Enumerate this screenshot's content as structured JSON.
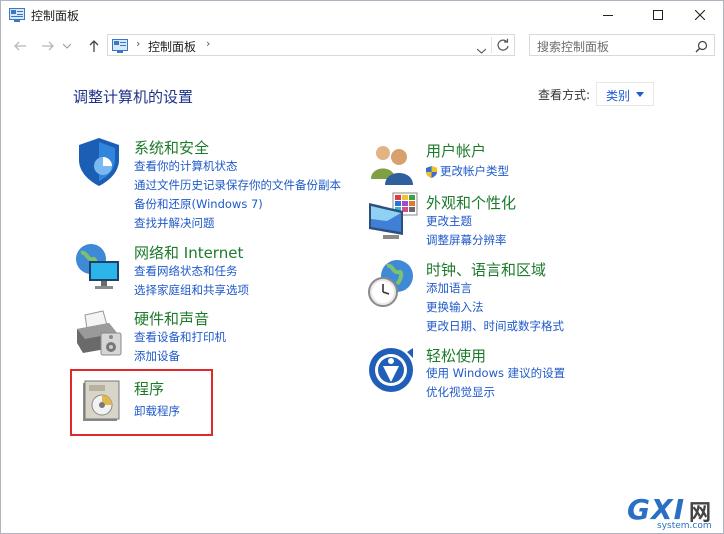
{
  "window": {
    "title": "控制面板",
    "controls": [
      "minimize-icon",
      "maximize-icon",
      "close-icon"
    ]
  },
  "nav": {
    "back_icon": "back-arrow-icon",
    "forward_icon": "forward-arrow-icon",
    "recent_icon": "chevron-down-icon",
    "up_icon": "up-arrow-icon",
    "breadcrumb": "控制面板",
    "search_placeholder": "搜索控制面板"
  },
  "main": {
    "heading": "调整计算机的设置",
    "view_by_label": "查看方式:",
    "view_by_value": "类别"
  },
  "categories_left": [
    {
      "title": "系统和安全",
      "icon": "shield-icon",
      "links": [
        "查看你的计算机状态",
        "通过文件历史记录保存你的文件备份副本",
        "备份和还原(Windows 7)",
        "查找并解决问题"
      ]
    },
    {
      "title": "网络和 Internet",
      "icon": "network-globe-icon",
      "links": [
        "查看网络状态和任务",
        "选择家庭组和共享选项"
      ]
    },
    {
      "title": "硬件和声音",
      "icon": "printer-icon",
      "links": [
        "查看设备和打印机",
        "添加设备"
      ]
    },
    {
      "title": "程序",
      "icon": "program-disc-icon",
      "links": [
        "卸载程序"
      ]
    }
  ],
  "categories_right": [
    {
      "title": "用户帐户",
      "icon": "users-icon",
      "links": [
        "更改帐户类型"
      ]
    },
    {
      "title": "外观和个性化",
      "icon": "monitor-palette-icon",
      "links": [
        "更改主题",
        "调整屏幕分辨率"
      ]
    },
    {
      "title": "时钟、语言和区域",
      "icon": "clock-globe-icon",
      "links": [
        "添加语言",
        "更换输入法",
        "更改日期、时间或数字格式"
      ]
    },
    {
      "title": "轻松使用",
      "icon": "ease-of-access-icon",
      "links": [
        "使用 Windows 建议的设置",
        "优化视觉显示"
      ]
    }
  ],
  "watermark": {
    "brand": "GXI",
    "suffix": "网",
    "url": "system.com"
  },
  "colors": {
    "heading": "#1e3287",
    "category_title": "#1c7a2b",
    "link": "#1f5ac9",
    "highlight": "#e0292b"
  }
}
